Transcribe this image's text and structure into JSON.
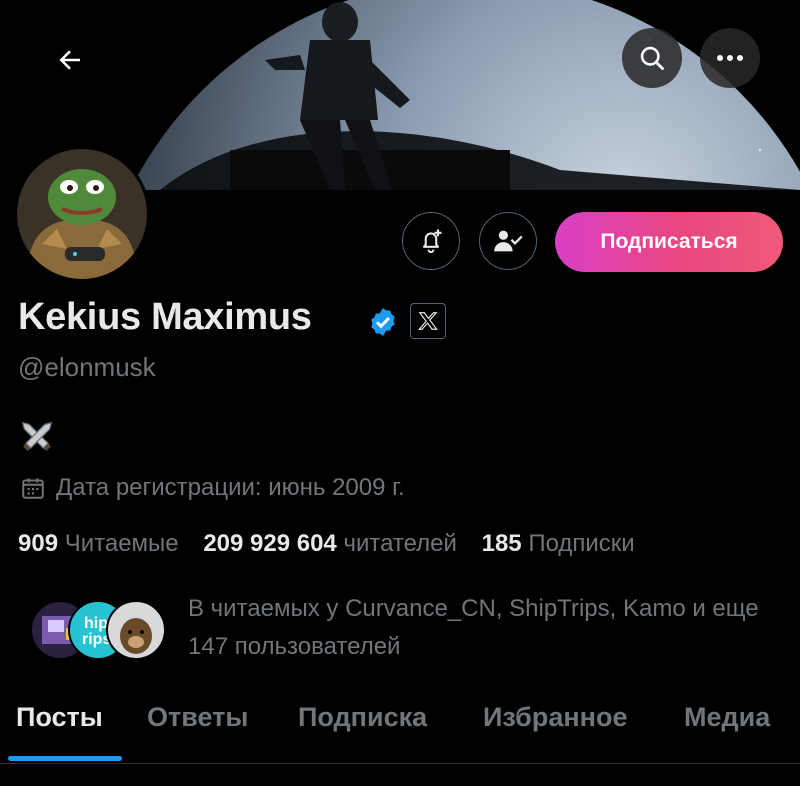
{
  "profile": {
    "name": "Kekius Maximus",
    "handle": "@elonmusk",
    "bio_emoji": "⚔️",
    "joined": "Дата регистрации: июнь 2009 г."
  },
  "actions": {
    "subscribe_label": "Подписаться"
  },
  "stats": {
    "following_count": "909",
    "following_label": "Читаемые",
    "followers_count": "209 929 604",
    "followers_label": "читателей",
    "subscriptions_count": "185",
    "subscriptions_label": "Подписки"
  },
  "followed_by": {
    "text": "В читаемых у Curvance_CN, ShipTrips, Kamo и еще 147 пользователей"
  },
  "tabs": [
    {
      "label": "Посты"
    },
    {
      "label": "Ответы"
    },
    {
      "label": "Подписка"
    },
    {
      "label": "Избранное"
    },
    {
      "label": "Медиа"
    }
  ],
  "colors": {
    "background": "#000000",
    "accent": "#1d9bf0",
    "verified": "#1d9bf0",
    "muted_text": "#71767b",
    "subscribe_gradient_start": "#d93fc6",
    "subscribe_gradient_end": "#f05a7a"
  },
  "icons": [
    "back-arrow-icon",
    "search-icon",
    "more-icon",
    "bell-plus-icon",
    "user-check-icon",
    "verified-badge-icon",
    "x-logo-icon",
    "calendar-icon"
  ]
}
